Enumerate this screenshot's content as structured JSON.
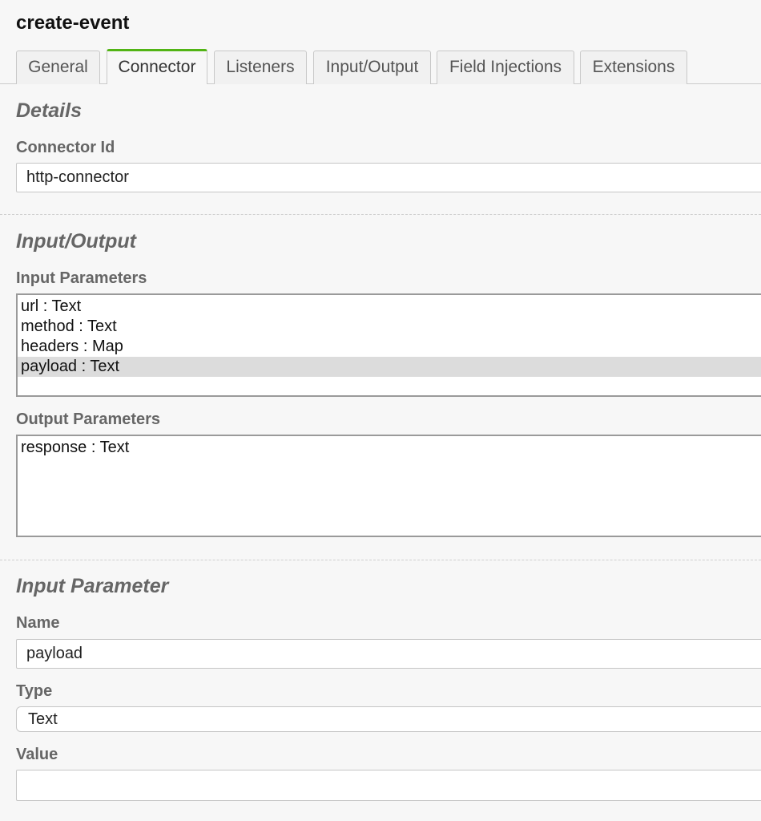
{
  "page": {
    "title": "create-event"
  },
  "tabs": [
    {
      "label": "General"
    },
    {
      "label": "Connector"
    },
    {
      "label": "Listeners"
    },
    {
      "label": "Input/Output"
    },
    {
      "label": "Field Injections"
    },
    {
      "label": "Extensions"
    }
  ],
  "active_tab": "Connector",
  "colors": {
    "active_tab_accent": "#52b415",
    "selected_row": "#dcdcdc"
  },
  "details": {
    "section_title": "Details",
    "connector_id_label": "Connector Id",
    "connector_id_value": "http-connector"
  },
  "io": {
    "section_title": "Input/Output",
    "input_params_label": "Input Parameters",
    "input_params": [
      {
        "text": "url : Text"
      },
      {
        "text": "method : Text"
      },
      {
        "text": "headers : Map"
      },
      {
        "text": "payload : Text"
      }
    ],
    "selected_input_param": "payload : Text",
    "output_params_label": "Output Parameters",
    "output_params": [
      {
        "text": "response : Text"
      }
    ]
  },
  "input_parameter": {
    "section_title": "Input Parameter",
    "name_label": "Name",
    "name_value": "payload",
    "type_label": "Type",
    "type_value": "Text",
    "value_label": "Value",
    "value_value": ""
  }
}
